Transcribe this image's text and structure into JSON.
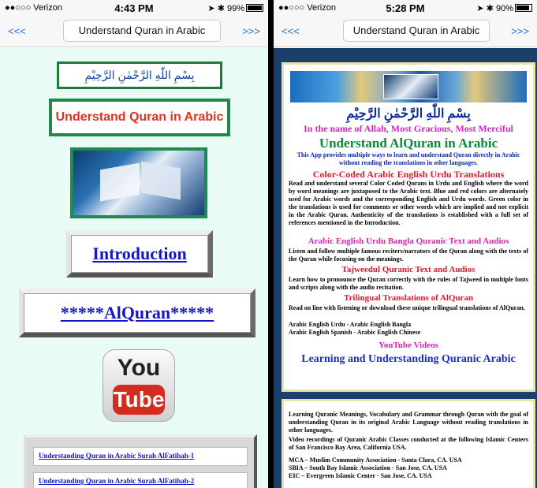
{
  "left_phone": {
    "status": {
      "carrier": "●●○○○ Verizon",
      "time": "4:43 PM",
      "right": "99%"
    },
    "nav": {
      "back": "<<<",
      "title": "Understand Quran in Arabic",
      "forward": ">>>"
    },
    "bismillah": "بِسْمِ اللّٰهِ الرَّحْمٰنِ الرَّحِيْمِ",
    "app_title": "Understand Quran in Arabic",
    "buttons": {
      "intro": "Introduction",
      "alquran": "*****AlQuran*****"
    },
    "youtube": {
      "you": "You",
      "tube": "Tube"
    },
    "links": [
      "Understanding Quran in Arabic Surah AlFatihah-1",
      "Understanding Quran in Arabic Surah AlFatihah-2"
    ]
  },
  "right_phone": {
    "status": {
      "carrier": "●●○○○ Verizon",
      "time": "5:28 PM",
      "right": "90%"
    },
    "nav": {
      "back": "<<<",
      "title": "Understand Quran in Arabic",
      "forward": ">>>"
    },
    "bismillah": "بِسْمِ اللّٰهِ الرَّحْمٰنِ الرَّحِيْمِ",
    "tagline": "In the name of Allah, Most Gracious, Most Merciful",
    "heading": "Understand AlQuran in Arabic",
    "intro_text": "This App provides multiple ways to learn and understand Quran directly in Arabic without reading the translations in other languages.",
    "sections": [
      {
        "title": "Color-Coded Arabic English Urdu Translations",
        "text": "Read and understand several Color Coded Qurans in Urdu and English where the word by word meanings are juxtaposed to the Arabic text. Blue and red colors are alternately used for Arabic words and the corresponding English and Urdu words. Green color in the translations is used for comments or other words which are implied and not explicit in the Arabic Quran. Authenticity of the translations is established with a full set of references mentioned in the Introduction."
      },
      {
        "title": "Arabic English Urdu Bangla Quranic Text and Audios",
        "text": "Listen and follow multiple famous reciters/narrators of the Quran along with the texts of the Quran while focusing on the meanings."
      },
      {
        "title": "Tajweedul Quranic Text and Audios",
        "text": "Learn how to pronounce the Quran correctly with the rules of Tajweed in multiple fonts and scripts along with the audio recitation."
      },
      {
        "title": "Trilingual Translations of AlQuran",
        "text": "Read on line with listening or download these unique trilingual translations of AlQuran."
      }
    ],
    "trilingual_lines": [
      "Arabic English Urdu    - Arabic English Bangla",
      "Arabic English Spanish - Arabic English Chinese"
    ],
    "youtube_label": "YouTube Videos",
    "youtube_heading": "Learning and Understanding Quranic Arabic",
    "panel2_text": "Learning Quranic Meanings, Vocabulary and Grammar through Quran with the goal of understanding Quran in its original Arabic Language without reading translations in other languages.",
    "panel2_text2": "Video recordings of Quranic Arabic Classes conducted at the following Islamic Centers of San Francisco Bay Area, California USA.",
    "centers": [
      "MCA – Muslim Community Association - Santa Clara, CA. USA",
      "SBIA – South Bay Islamic Association   - San Jose, CA. USA",
      "EIC  – Evergreen Islamic Center        - San Jose, CA. USA"
    ]
  }
}
